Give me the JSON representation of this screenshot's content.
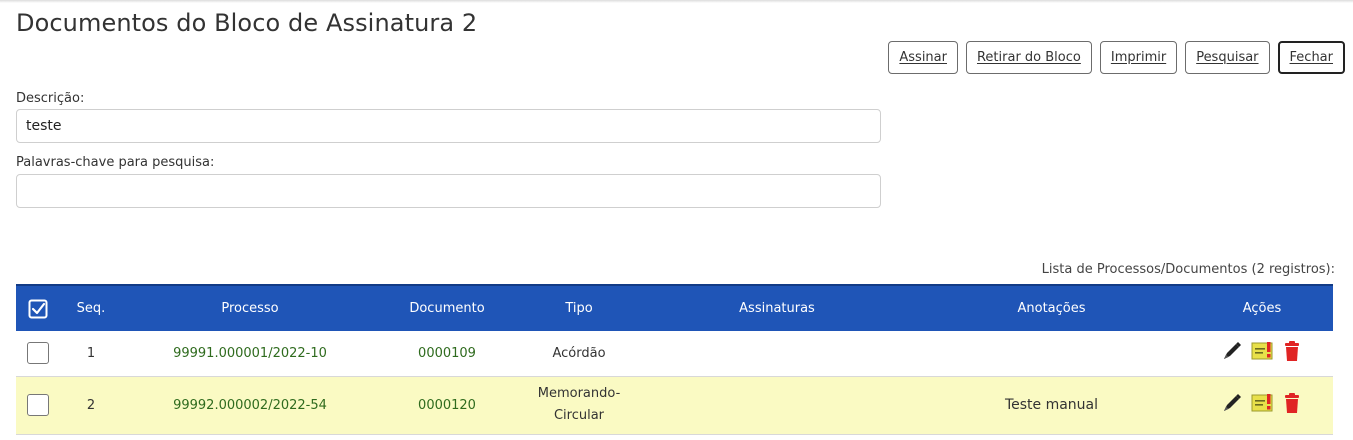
{
  "page": {
    "title": "Documentos do Bloco de Assinatura 2"
  },
  "toolbar": {
    "buttons": [
      {
        "label": "Assinar"
      },
      {
        "label": "Retirar do Bloco"
      },
      {
        "label": "Imprimir"
      },
      {
        "label": "Pesquisar"
      },
      {
        "label": "Fechar"
      }
    ]
  },
  "form": {
    "descricao_label": "Descrição:",
    "descricao_value": "teste",
    "palavras_label": "Palavras-chave para pesquisa:",
    "palavras_value": ""
  },
  "table": {
    "caption": "Lista de Processos/Documentos (2 registros):",
    "headers": {
      "seq": "Seq.",
      "processo": "Processo",
      "documento": "Documento",
      "tipo": "Tipo",
      "assinaturas": "Assinaturas",
      "anotacoes": "Anotações",
      "acoes": "Ações"
    },
    "rows": [
      {
        "seq": "1",
        "processo": "99991.000001/2022-10",
        "documento": "0000109",
        "tipo": "Acórdão",
        "assinaturas": "",
        "anotacoes": "",
        "actions": [
          "pen-icon",
          "annotation-icon",
          "trash-icon"
        ]
      },
      {
        "seq": "2",
        "processo": "99992.000002/2022-54",
        "documento": "0000120",
        "tipo": "Memorando-Circular",
        "assinaturas": "",
        "anotacoes": "Teste manual",
        "actions": [
          "pen-icon",
          "annotation-icon",
          "trash-icon"
        ]
      }
    ]
  },
  "colors": {
    "header_bg": "#1f55b7",
    "link_green": "#2f6b1e",
    "highlight_row": "#fafac3",
    "trash_red": "#e02424",
    "annotation_yellow": "#e8e04a"
  }
}
